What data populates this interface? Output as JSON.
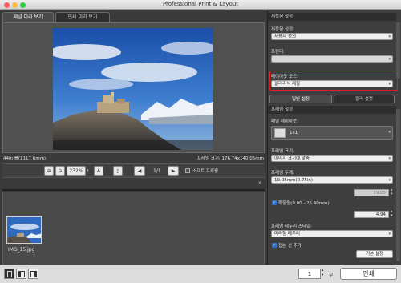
{
  "window": {
    "title": "Professional Print & Layout"
  },
  "tabs": [
    {
      "label": "패널 미리 보기"
    },
    {
      "label": "인쇄 미리 보기"
    }
  ],
  "status": {
    "left": "44in 롤(1117.6mm)",
    "right": "프레임 크기: 176.74x140.05mm"
  },
  "toolbar": {
    "zoom_value": "232%",
    "page_indicator": "1/1",
    "soft_proof_label": "소프트 프루핑"
  },
  "thumbnail": {
    "filename": "IMG_15.jpg"
  },
  "right_panel": {
    "saved_settings_header": "저장된 설정",
    "saved_settings_label": "저장된 설정:",
    "saved_settings_value": "사용자 정의",
    "printer_label": "프린터:",
    "printer_value": "",
    "layout_mode_label": "레이아웃 모드:",
    "layout_mode_value": "갤러리식 래핑",
    "subtabs": [
      {
        "label": "일반 설정"
      },
      {
        "label": "컬러 설정"
      }
    ],
    "frame_settings_header": "프레임 설정",
    "panel_layout_label": "패널 레이아웃:",
    "panel_layout_value": "1x1",
    "frame_size_label": "프레임 크기:",
    "frame_size_value": "이미지 크기에 맞춤",
    "frame_thickness_label": "프레임 두께:",
    "frame_thickness_value": "19.05mm(0.75in)",
    "thickness_number": "19.05",
    "extension_label": "확장량(0.00 - 25.40mm):",
    "extension_number": "4.94",
    "border_style_label": "프레임 테두리 스타일:",
    "border_style_value": "미러형 테두리",
    "add_line_label": "접는 선 추가",
    "default_button": "기본 설정"
  },
  "bottom": {
    "copies": "1",
    "copies_unit": "부",
    "print_button": "인쇄"
  },
  "colors": {
    "highlight_box": "#e02020",
    "checkbox": "#2d6fd6"
  }
}
